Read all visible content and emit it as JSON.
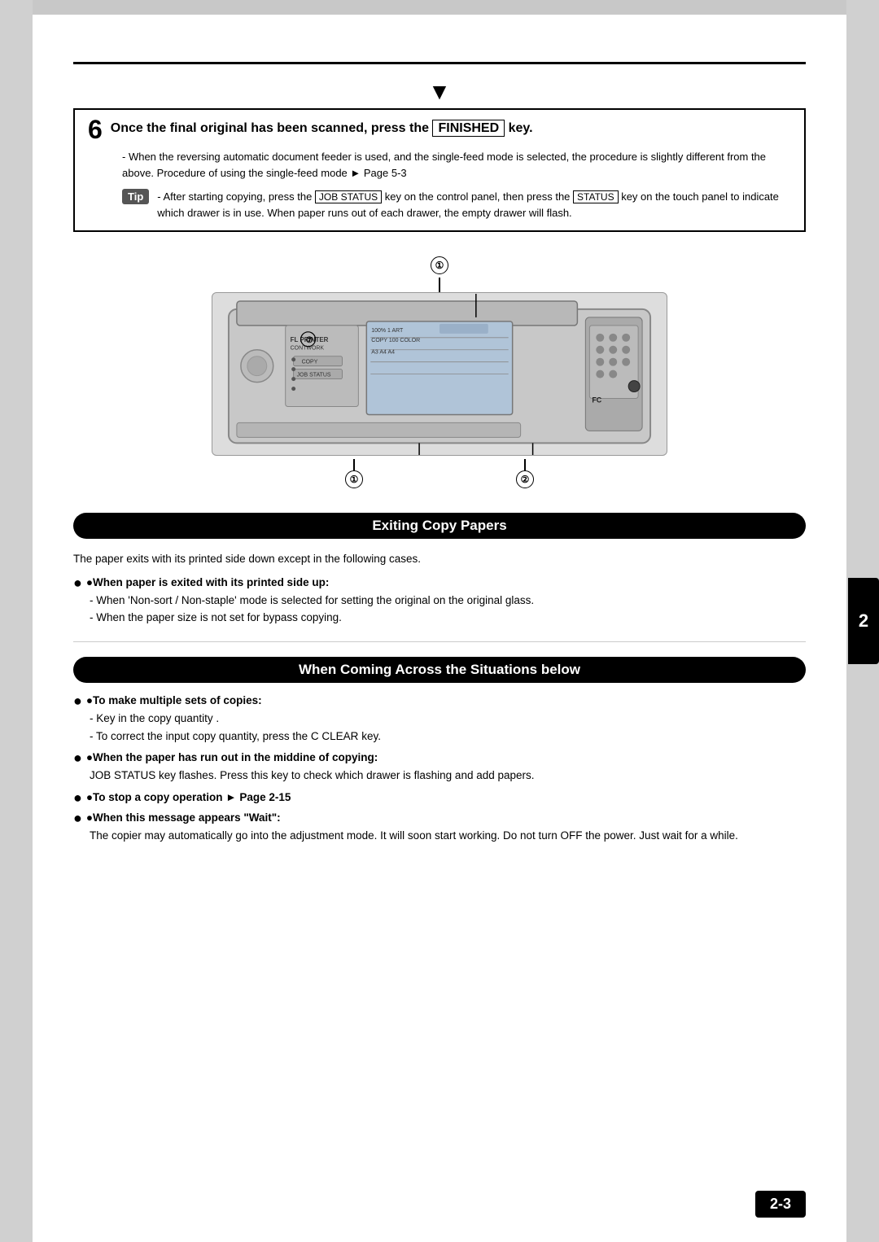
{
  "page": {
    "step_number": "6",
    "step_title_pre": "Once the final original has been scanned, press the ",
    "step_key": "FINISHED",
    "step_title_post": " key.",
    "step_body": "- When the reversing automatic document feeder is used, and the single-feed mode is selected, the procedure is slightly different from the above. Procedure of using the single-feed mode ► Page 5-3",
    "tip_label": "Tip",
    "tip_text_pre": "- After starting copying, press the ",
    "tip_key1": "JOB STATUS",
    "tip_text_mid": " key on the control panel, then press the ",
    "tip_key2": "STATUS",
    "tip_text_post": " key on the touch panel to indicate which drawer is in use. When paper runs out of each drawer, the empty drawer will flash.",
    "section1_heading": "Exiting Copy Papers",
    "section1_body": "The paper exits with its printed side down except in the following cases.",
    "bullet1_label": "●When paper is exited with its printed side up:",
    "bullet1_sub1": "- When  'Non-sort / Non-staple' mode is selected for setting the original on the original glass.",
    "bullet1_sub2": "- When the paper size is not set for bypass copying.",
    "section2_heading": "When Coming Across the Situations below",
    "bullet2_label": "●To make multiple sets of copies:",
    "bullet2_sub1": "- Key in the copy quantity .",
    "bullet2_sub2": "- To correct the input copy quantity, press the ",
    "bullet2_key": "C CLEAR",
    "bullet2_sub2_post": " key.",
    "bullet3_label": "●When the paper has run out in the middine of copying:",
    "bullet3_key": "JOB STATUS",
    "bullet3_body": " key flashes. Press this key to check which drawer is flashing and add papers.",
    "bullet4_label": "●To stop a copy operation ► Page 2-15",
    "bullet5_label": "●When this message appears \"Wait\":",
    "bullet5_body": "The copier may automatically go into the adjustment mode.  It will soon start working.  Do not turn OFF the power.  Just wait for a while.",
    "side_tab": "2",
    "page_number": "2-3"
  }
}
